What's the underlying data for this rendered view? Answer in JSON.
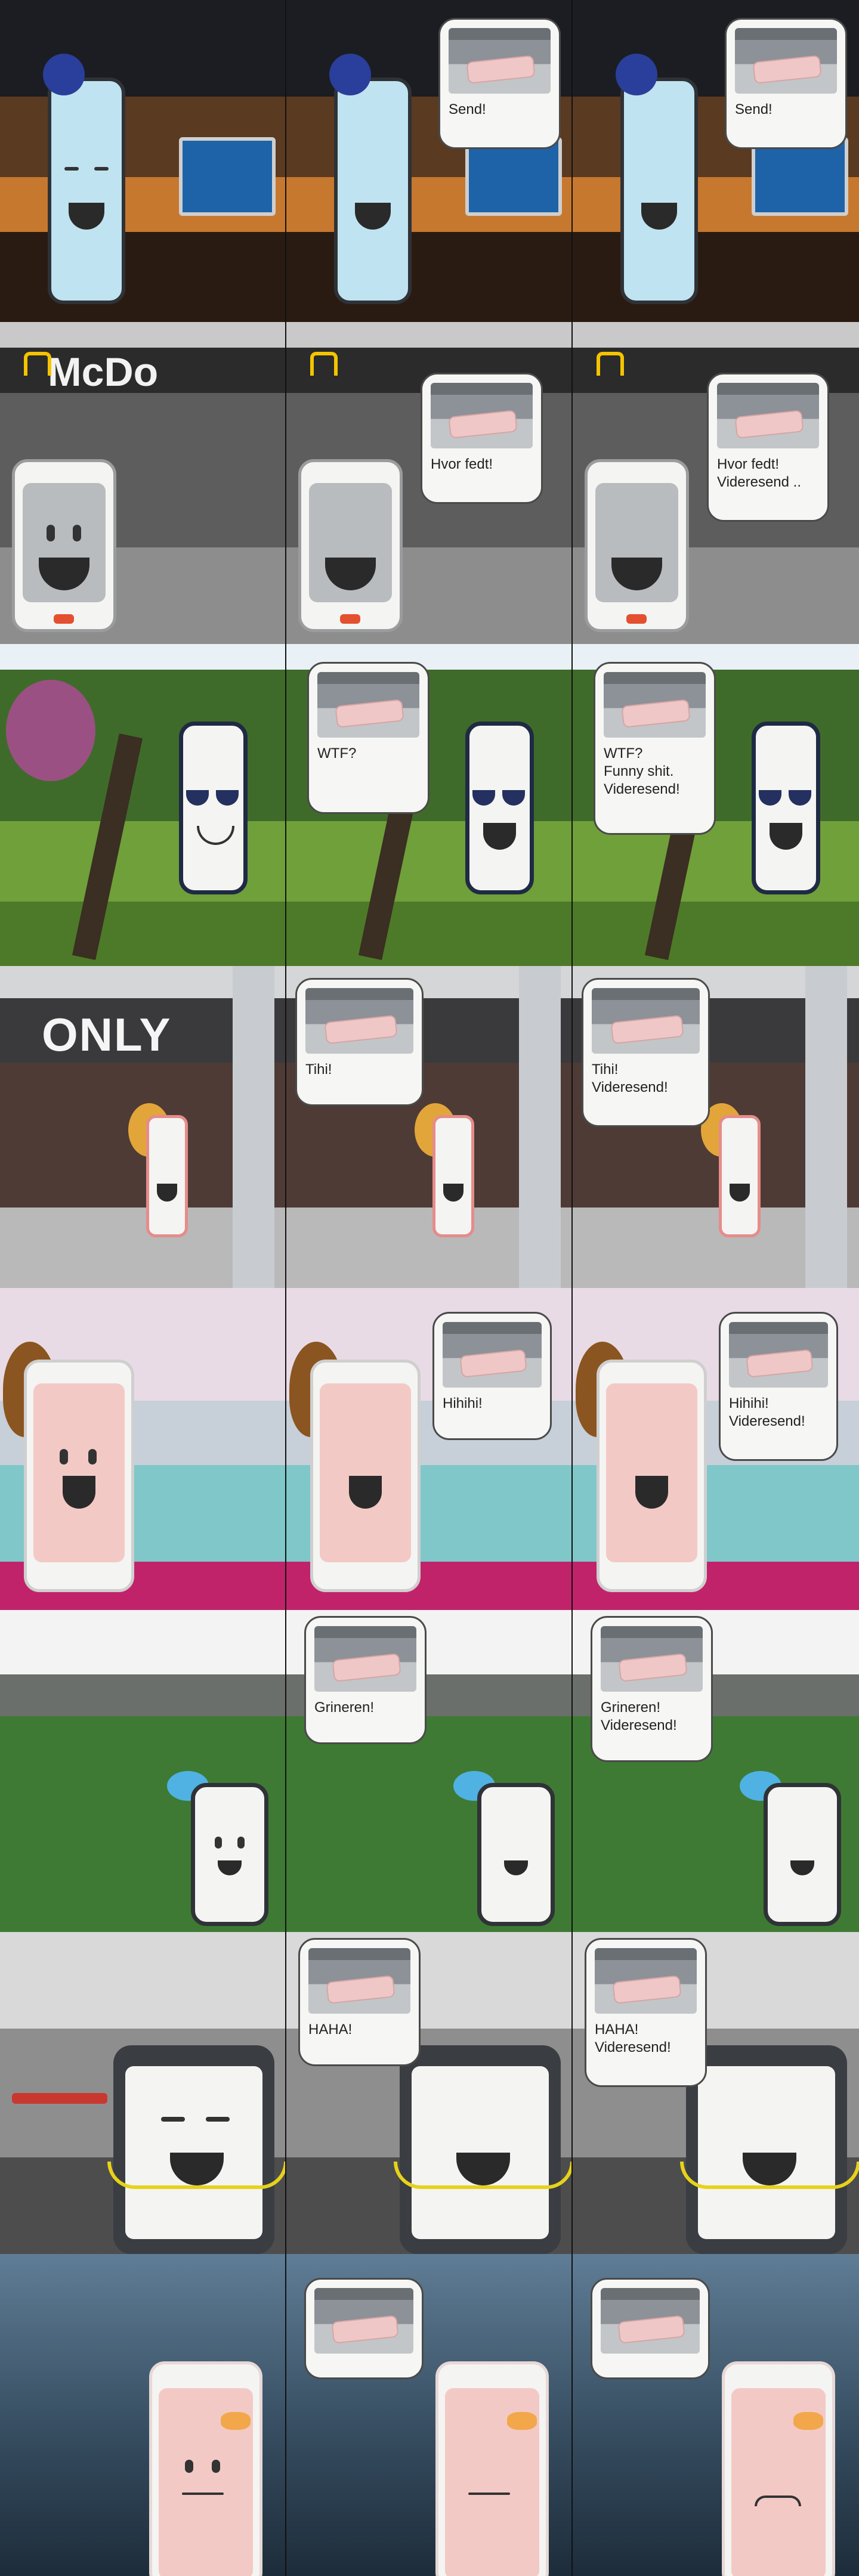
{
  "rows": [
    {
      "scene": "office",
      "texts": [
        "",
        "Send!",
        "Send!"
      ]
    },
    {
      "scene": "mcdonalds",
      "sign": "McDo",
      "texts": [
        "",
        "Hvor fedt!",
        "Hvor fedt!\nVideresend .."
      ]
    },
    {
      "scene": "park",
      "texts": [
        "",
        "WTF?",
        "WTF?\nFunny shit.\nVideresend!"
      ]
    },
    {
      "scene": "mall",
      "sign": "ONLY",
      "texts": [
        "",
        "Tihi!",
        "Tihi!\nVideresend!"
      ]
    },
    {
      "scene": "bedroom",
      "texts": [
        "",
        "Hihihi!",
        "Hihihi!\nVideresend!"
      ]
    },
    {
      "scene": "stadium",
      "texts": [
        "",
        "Grineren!",
        "Grineren!\nVideresend!"
      ]
    },
    {
      "scene": "gym",
      "texts": [
        "",
        "HAHA!",
        "HAHA!\nVideresend!"
      ]
    },
    {
      "scene": "rain",
      "texts": [
        "",
        "",
        ""
      ]
    }
  ],
  "colors": {
    "phone_blue": "#bfe3f0",
    "phone_pink": "#f3c9c6",
    "phone_grey": "#b9bcbe",
    "phone_white": "#f4f4f2",
    "dark_frame": "#2f3236"
  }
}
